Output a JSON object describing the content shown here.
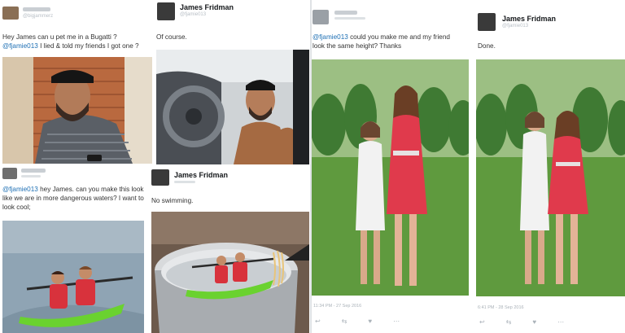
{
  "panel1": {
    "handle": "@bigjammerz",
    "text_line1": "Hey James can u pet me in a Bugatti ?",
    "mention": "@fjamie013",
    "text_line2_rest": " I lied & told my friends I got one ?"
  },
  "panel2": {
    "name": "James Fridman",
    "handle": "@fjamie013",
    "text": "Of course."
  },
  "panel3": {
    "mention": "@fjamie013",
    "text_rest1": " hey James. can you make this look",
    "text_line2": "like we are in more dangerous waters? I want to",
    "text_line3": "look cool;"
  },
  "panel4": {
    "name": "James Fridman",
    "text": "No swimming."
  },
  "panel5": {
    "mention": "@fjamie013",
    "text_rest1": " could you make me and my friend",
    "text_line2": "look the same height? Thanks",
    "timestamp": "11:34 PM - 27 Sep 2016"
  },
  "panel6": {
    "name": "James Fridman",
    "handle": "@fjamie013",
    "text": "Done.",
    "timestamp": "6:41 PM - 28 Sep 2016"
  },
  "icons": [
    "reply-icon",
    "retweet-icon",
    "like-icon",
    "more-icon"
  ],
  "colors": {
    "mention": "#1d6fb4",
    "grass": "#5f9a3e",
    "dress_red": "#e03a4c",
    "kayak": "#6fd23a"
  }
}
